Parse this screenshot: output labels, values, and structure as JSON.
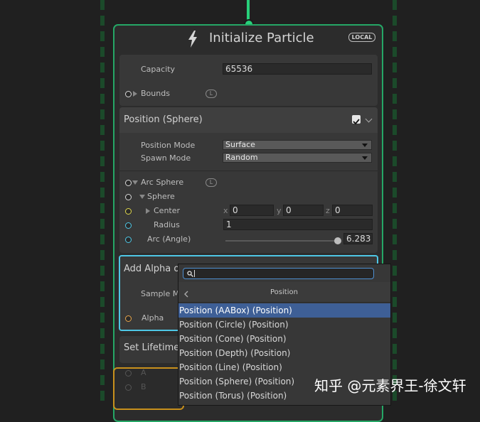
{
  "context": {
    "title": "Initialize Particle",
    "badge": "LOCAL",
    "icon": "bolt-icon",
    "accent_color": "#25a766"
  },
  "capacity_block": {
    "capacity_label": "Capacity",
    "capacity_value": "65536",
    "bounds_label": "Bounds",
    "bounds_badge": "L"
  },
  "position_sphere": {
    "title": "Position (Sphere)",
    "position_mode_label": "Position Mode",
    "position_mode_value": "Surface",
    "spawn_mode_label": "Spawn Mode",
    "spawn_mode_value": "Random",
    "arc_sphere_label": "Arc Sphere",
    "arc_sphere_badge": "L",
    "sphere_label": "Sphere",
    "center_label": "Center",
    "center_x_label": "x",
    "center_x": "0",
    "center_y_label": "y",
    "center_y": "0",
    "center_z_label": "z",
    "center_z": "0",
    "radius_label": "Radius",
    "radius_value": "1",
    "arc_label": "Arc (Angle)",
    "arc_value": "6.283"
  },
  "add_alpha": {
    "title": "Add Alpha ov",
    "sample_label": "Sample M",
    "alpha_label": "Alpha",
    "highlight_color": "#4ec7e6"
  },
  "set_lifetime": {
    "title": "Set Lifetime"
  },
  "bottom_block": {
    "port_a": "A",
    "port_b": "B"
  },
  "popup": {
    "category": "Position",
    "items": [
      "Position (AABox) (Position)",
      "Position (Circle) (Position)",
      "Position (Cone) (Position)",
      "Position (Depth) (Position)",
      "Position (Line) (Position)",
      "Position (Sphere) (Position)",
      "Position (Torus) (Position)"
    ],
    "selected_color": "#3e5f96"
  },
  "watermark": "知乎 @元素界王-徐文轩"
}
